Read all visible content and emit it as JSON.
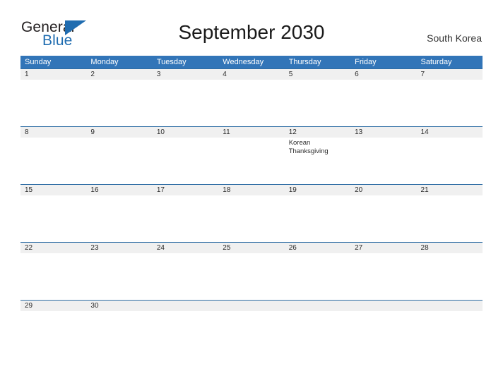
{
  "header": {
    "logo": {
      "word_one": "General",
      "word_two": "Blue",
      "flag_color": "#1f6cb0",
      "text_color": "#231f20"
    },
    "title": "September 2030",
    "region": "South Korea"
  },
  "calendar": {
    "accent_color": "#3275b8",
    "row_line_color": "#2e6da4",
    "band_color": "#f0f0f0",
    "weekdays": [
      "Sunday",
      "Monday",
      "Tuesday",
      "Wednesday",
      "Thursday",
      "Friday",
      "Saturday"
    ],
    "weeks": [
      {
        "size": "tall",
        "days": [
          {
            "num": "1",
            "event": ""
          },
          {
            "num": "2",
            "event": ""
          },
          {
            "num": "3",
            "event": ""
          },
          {
            "num": "4",
            "event": ""
          },
          {
            "num": "5",
            "event": ""
          },
          {
            "num": "6",
            "event": ""
          },
          {
            "num": "7",
            "event": ""
          }
        ]
      },
      {
        "size": "tall",
        "days": [
          {
            "num": "8",
            "event": ""
          },
          {
            "num": "9",
            "event": ""
          },
          {
            "num": "10",
            "event": ""
          },
          {
            "num": "11",
            "event": ""
          },
          {
            "num": "12",
            "event": "Korean Thanksgiving"
          },
          {
            "num": "13",
            "event": ""
          },
          {
            "num": "14",
            "event": ""
          }
        ]
      },
      {
        "size": "tall",
        "days": [
          {
            "num": "15",
            "event": ""
          },
          {
            "num": "16",
            "event": ""
          },
          {
            "num": "17",
            "event": ""
          },
          {
            "num": "18",
            "event": ""
          },
          {
            "num": "19",
            "event": ""
          },
          {
            "num": "20",
            "event": ""
          },
          {
            "num": "21",
            "event": ""
          }
        ]
      },
      {
        "size": "tall",
        "days": [
          {
            "num": "22",
            "event": ""
          },
          {
            "num": "23",
            "event": ""
          },
          {
            "num": "24",
            "event": ""
          },
          {
            "num": "25",
            "event": ""
          },
          {
            "num": "26",
            "event": ""
          },
          {
            "num": "27",
            "event": ""
          },
          {
            "num": "28",
            "event": ""
          }
        ]
      },
      {
        "size": "short",
        "days": [
          {
            "num": "29",
            "event": ""
          },
          {
            "num": "30",
            "event": ""
          },
          {
            "num": "",
            "event": ""
          },
          {
            "num": "",
            "event": ""
          },
          {
            "num": "",
            "event": ""
          },
          {
            "num": "",
            "event": ""
          },
          {
            "num": "",
            "event": ""
          }
        ]
      }
    ]
  }
}
